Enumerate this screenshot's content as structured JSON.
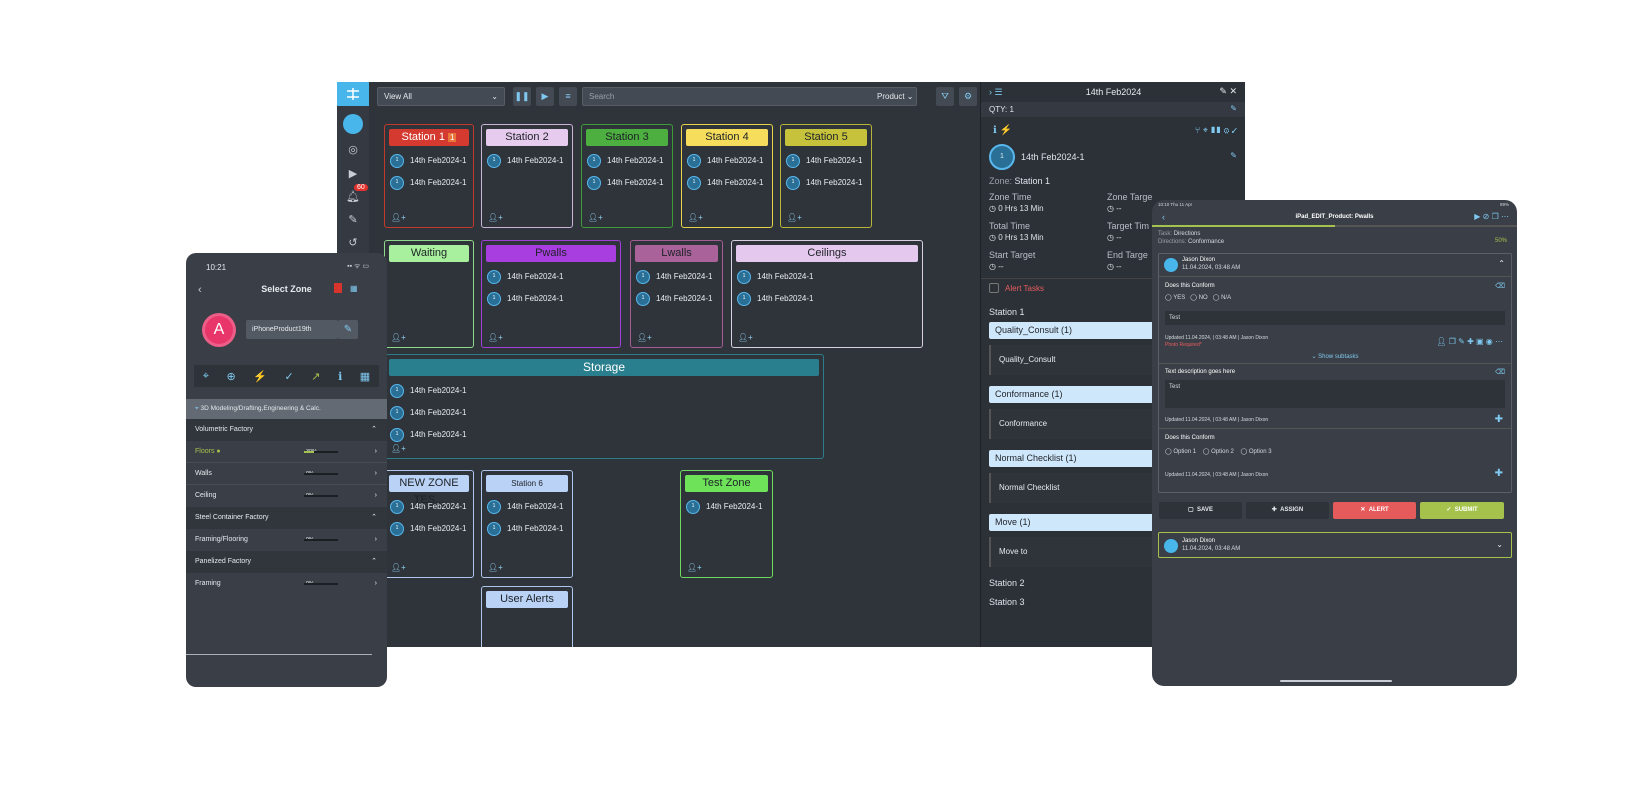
{
  "desktop": {
    "view_select": "View All",
    "search_placeholder": "Search",
    "product_select": "Product",
    "notification_count": "60",
    "zones": {
      "s1": {
        "name": "Station 1",
        "badge": "1",
        "items": [
          "14th Feb2024-1",
          "14th Feb2024-1"
        ]
      },
      "s2": {
        "name": "Station 2",
        "items": [
          "14th Feb2024-1"
        ]
      },
      "s3": {
        "name": "Station 3",
        "items": [
          "14th Feb2024-1",
          "14th Feb2024-1"
        ]
      },
      "s4": {
        "name": "Station 4",
        "items": [
          "14th Feb2024-1",
          "14th Feb2024-1"
        ]
      },
      "s5": {
        "name": "Station 5",
        "items": [
          "14th Feb2024-1",
          "14th Feb2024-1"
        ]
      },
      "waiting": {
        "name": "Waiting"
      },
      "pwalls": {
        "name": "Pwalls",
        "items": [
          "14th Feb2024-1",
          "14th Feb2024-1"
        ]
      },
      "lwalls": {
        "name": "Lwalls",
        "items": [
          "14th Feb2024-1",
          "14th Feb2024-1"
        ]
      },
      "ceilings": {
        "name": "Ceilings",
        "items": [
          "14th Feb2024-1",
          "14th Feb2024-1"
        ]
      },
      "storage": {
        "name": "Storage",
        "items": [
          "14th Feb2024-1",
          "14th Feb2024-1",
          "14th Feb2024-1"
        ]
      },
      "newzone": {
        "name": "NEW ZONE TES...",
        "items": [
          "14th Feb2024-1",
          "14th Feb2024-1"
        ]
      },
      "s6": {
        "name": "Station 6",
        "items": [
          "14th Feb2024-1",
          "14th Feb2024-1"
        ]
      },
      "test": {
        "name": "Test Zone",
        "items": [
          "14th Feb2024-1"
        ]
      },
      "alerts": {
        "name": "User Alerts"
      }
    },
    "panel": {
      "title": "14th Feb2024",
      "qty": "QTY: 1",
      "item": "14th Feb2024-1",
      "zone_label": "Zone:",
      "zone_value": "Station 1",
      "zone_time_label": "Zone Time",
      "zone_time": "0 Hrs 13 Min",
      "zone_target_label": "Zone Targe",
      "zone_target": "--",
      "total_time_label": "Total Time",
      "total_time": "0 Hrs 13 Min",
      "target_time_label": "Target Tim",
      "target_time": "--",
      "start_target_label": "Start Target",
      "start_target": "--",
      "end_target_label": "End Targe",
      "end_target": "--",
      "alert_tasks": "Alert Tasks",
      "station1": "Station 1",
      "tasks": [
        {
          "header": "Quality_Consult (1)",
          "body": "Quality_Consult"
        },
        {
          "header": "Conformance (1)",
          "body": "Conformance"
        },
        {
          "header": "Normal Checklist (1)",
          "body": "Normal Checklist"
        },
        {
          "header": "Move (1)",
          "body": "Move to"
        }
      ],
      "station2": "Station 2",
      "station3": "Station 3"
    }
  },
  "phone": {
    "time": "10:21",
    "title": "Select Zone",
    "avatar": "A",
    "product": "iPhoneProduct19th",
    "location": "3D Modeling/Drafting,Engineering & Calc.",
    "rows": [
      {
        "label": "Volumetric Factory",
        "type": "group"
      },
      {
        "label": "Floors",
        "pct": "30%",
        "fill": 0.3,
        "type": "item",
        "active": true
      },
      {
        "label": "Walls",
        "pct": "0%",
        "fill": 0,
        "type": "item"
      },
      {
        "label": "Ceiling",
        "pct": "0%",
        "fill": 0,
        "type": "item"
      },
      {
        "label": "Steel Container Factory",
        "type": "group"
      },
      {
        "label": "Framing/Flooring",
        "pct": "0%",
        "fill": 0,
        "type": "item"
      },
      {
        "label": "Panelized Factory",
        "type": "group"
      },
      {
        "label": "Framing",
        "pct": "0%",
        "fill": 0,
        "type": "item"
      }
    ]
  },
  "tablet": {
    "status_left": "10:10  Thu 11 Apr",
    "status_right": "89%",
    "title": "iPad_EDIT_Product: Pwalls",
    "task_label": "Task:",
    "task_value": "Directions",
    "dir_label": "Directions:",
    "dir_value": "Conformance",
    "progress": "50%",
    "user": "Jason Dixon",
    "user_time": "11.04.2024, 03:48 AM",
    "q1": "Does this Conform",
    "opt_yes": "YES",
    "opt_no": "NO",
    "opt_na": "N/A",
    "answer1": "Test",
    "updated1": "Updated 11.04.2024, | 03:48 AM | Jason Dixon",
    "photo_required": "Photo Required*",
    "show_subtasks": "Show subtasks",
    "q2": "Text description goes here",
    "answer2": "Test",
    "updated2": "Updated 11.04.2024, | 03:48 AM | Jason Dixon",
    "q3": "Does this Conform",
    "opt1": "Option 1",
    "opt2": "Option 2",
    "opt3": "Option 3",
    "updated3": "Updated 11.04.2024, | 03:48 AM | Jason Dixon",
    "save": "SAVE",
    "assign": "ASSIGN",
    "alert": "ALERT",
    "submit": "SUBMIT",
    "user2": "Jason Dixon",
    "user2_time": "11.04.2024, 03:48 AM"
  }
}
